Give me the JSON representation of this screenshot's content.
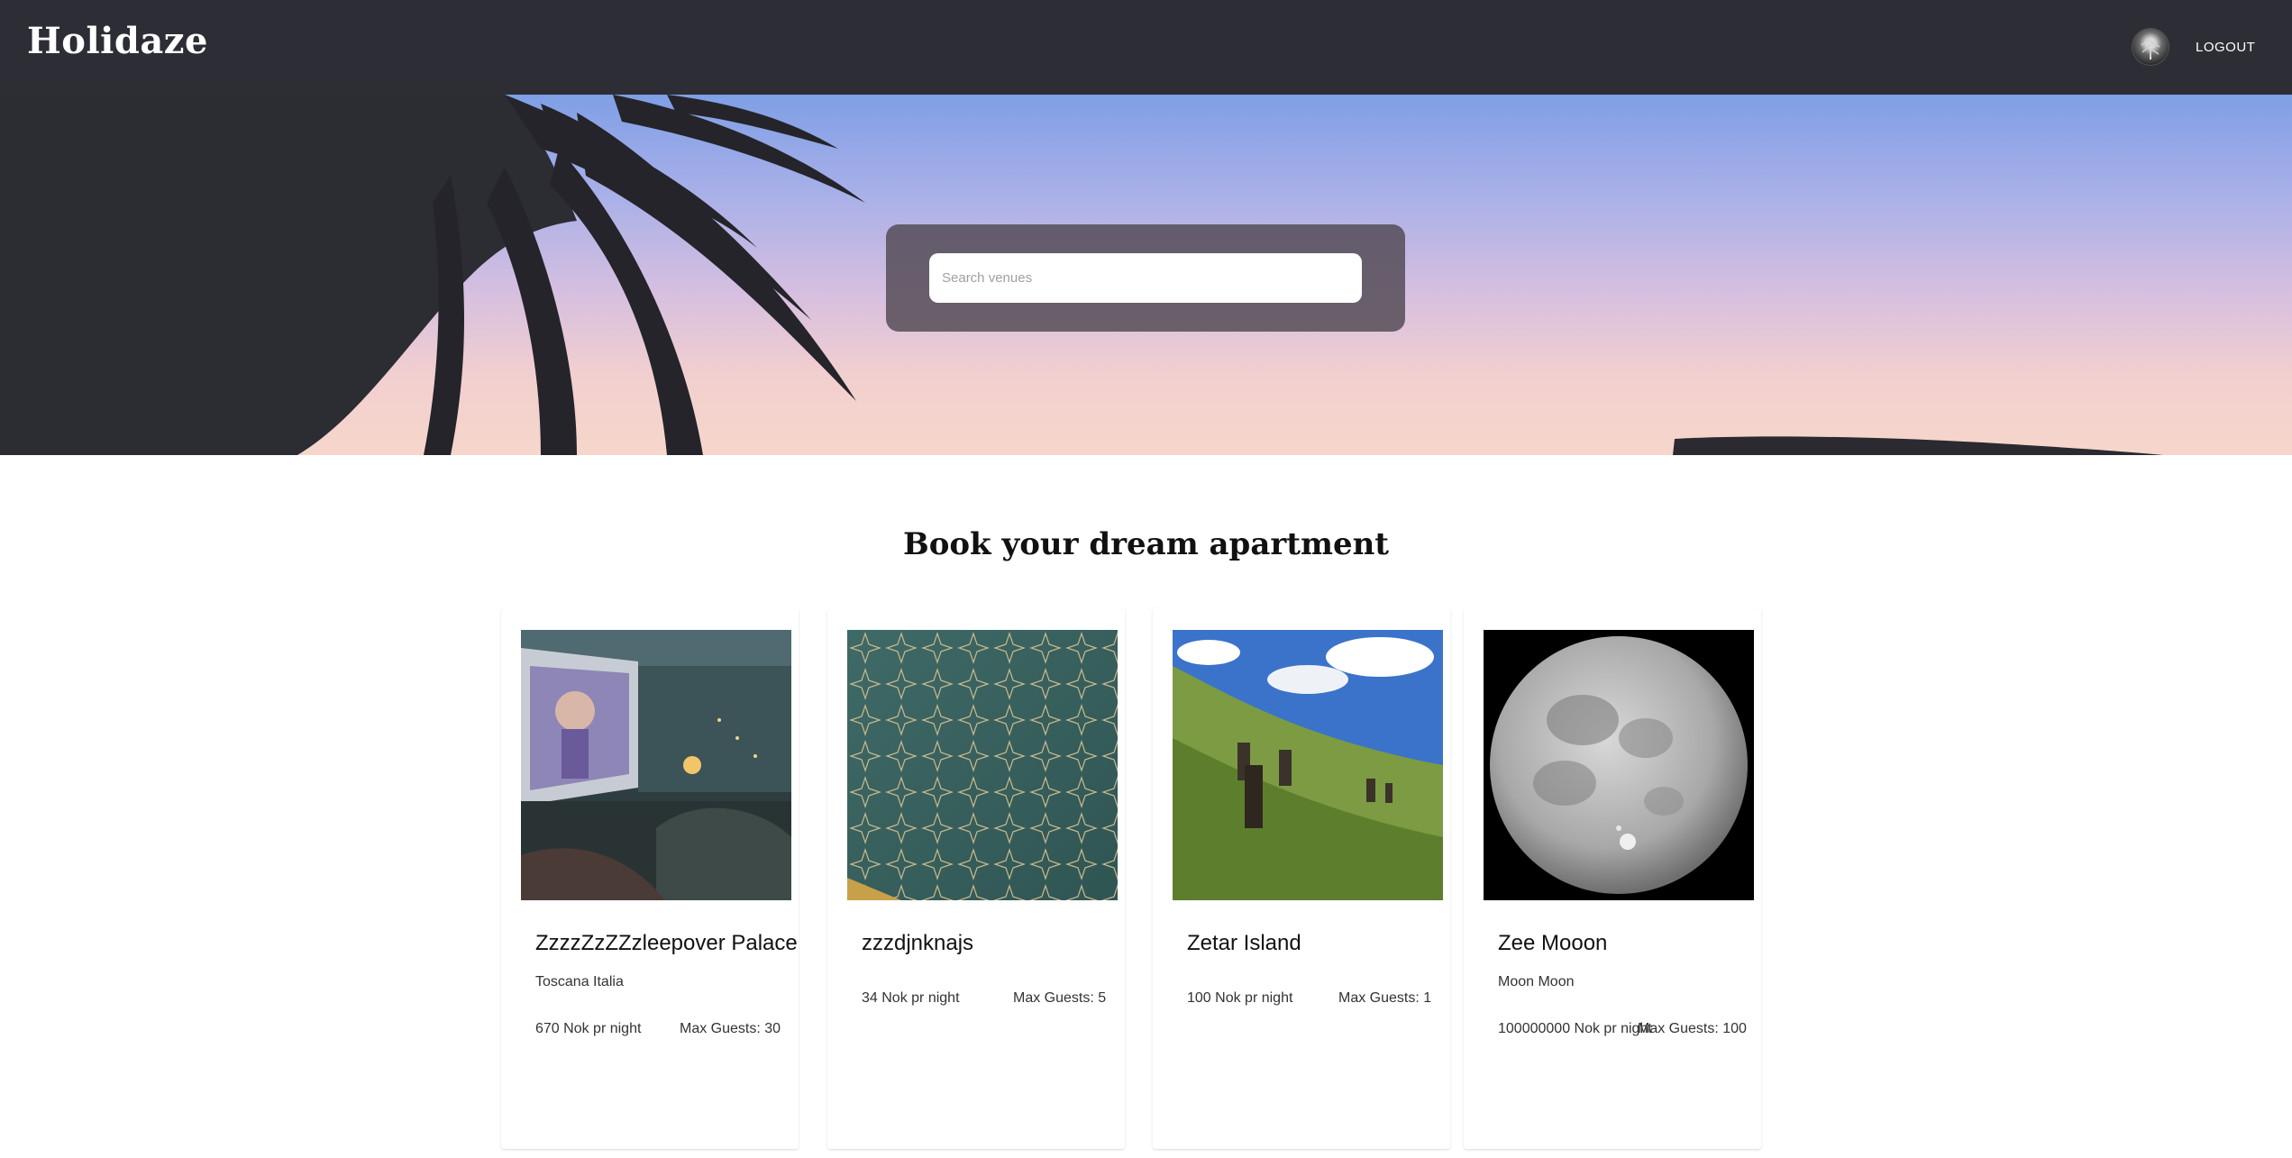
{
  "header": {
    "logo": "Holidaze",
    "logout_label": "LOGOUT"
  },
  "search": {
    "placeholder": "Search venues",
    "value": ""
  },
  "section_title": "Book your dream apartment",
  "venues": [
    {
      "name": "ZzzzZzZZzleepover Palace",
      "location": "Toscana Italia",
      "price": "670 Nok pr night",
      "guests": "Max Guests: 30",
      "image": "outdoor-cinema"
    },
    {
      "name": "zzzdjnknajs",
      "location": "",
      "price": "34 Nok pr night",
      "guests": "Max Guests: 5",
      "image": "patterned-wall"
    },
    {
      "name": "Zetar Island",
      "location": "",
      "price": "100 Nok pr night",
      "guests": "Max Guests: 1",
      "image": "island-statues"
    },
    {
      "name": "Zee Mooon",
      "location": "Moon Moon",
      "price": "100000000 Nok pr night",
      "guests": "Max Guests: 100",
      "image": "full-moon"
    }
  ],
  "colors": {
    "header_bg": "#2d2e35",
    "search_panel": "#504852"
  }
}
